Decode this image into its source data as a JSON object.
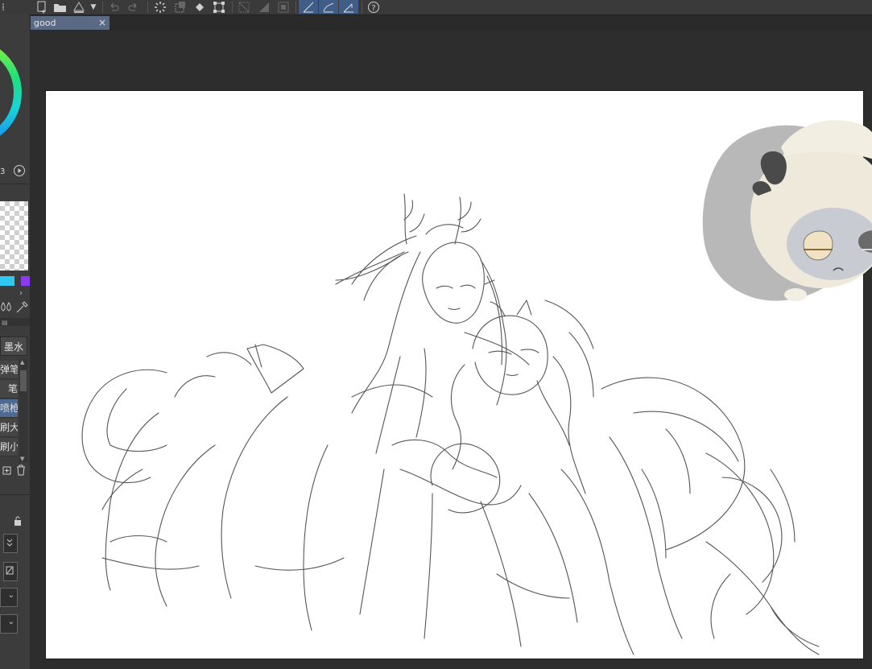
{
  "document": {
    "tab_title": "good",
    "close_glyph": "×"
  },
  "toolbar": {
    "icons": [
      "new-file-icon",
      "open-file-icon",
      "save-icon",
      "dropdown-arrow-icon",
      "undo-icon",
      "redo-icon",
      "loading-icon",
      "clear-icon",
      "fill-icon",
      "transform-icon",
      "deselect-icon",
      "invert-selection-icon",
      "selection-mask-icon",
      "snap-ruler-icon",
      "snap-special-ruler-icon",
      "snap-grid-icon",
      "help-icon"
    ]
  },
  "left_panel": {
    "color_value_fragment": "3",
    "sub_tool_group": "墨水",
    "brushes": [
      "弹笔",
      "笔",
      "喷枪器",
      "刷大",
      "刷小"
    ],
    "colors": {
      "swatch_cyan": "#2ec8f0",
      "swatch_purple": "#8a3cf0",
      "selected_item": "#4e6a92"
    }
  },
  "colors": {
    "toolbar_bg": "#3a3a3a",
    "active_toggle": "#3f5d86",
    "tab_active": "#5a6a84",
    "workspace": "#2d2d2d",
    "canvas": "#ffffff",
    "sketch_line": "#555555"
  }
}
